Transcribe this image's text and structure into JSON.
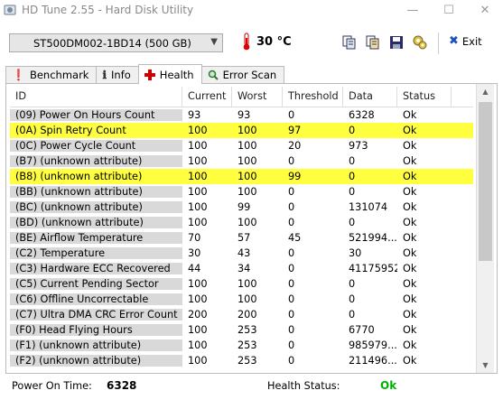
{
  "window": {
    "title": "HD Tune 2.55 - Hard Disk Utility",
    "minimize": "—",
    "maximize": "☐",
    "close": "✕"
  },
  "toolbar": {
    "drive": "ST500DM002-1BD14 (500 GB)",
    "temperature": "30 °C",
    "exit_label": "Exit"
  },
  "tabs": [
    {
      "label": "Benchmark",
      "icon": "benchmark-icon",
      "active": false
    },
    {
      "label": "Info",
      "icon": "info-icon",
      "active": false
    },
    {
      "label": "Health",
      "icon": "health-cross-icon",
      "active": true
    },
    {
      "label": "Error Scan",
      "icon": "magnifier-icon",
      "active": false
    }
  ],
  "table": {
    "columns": [
      "ID",
      "Current",
      "Worst",
      "Threshold",
      "Data",
      "Status"
    ],
    "rows": [
      {
        "id": "(09) Power On Hours Count",
        "current": "93",
        "worst": "93",
        "threshold": "0",
        "data": "6328",
        "status": "Ok",
        "warn": false
      },
      {
        "id": "(0A) Spin Retry Count",
        "current": "100",
        "worst": "100",
        "threshold": "97",
        "data": "0",
        "status": "Ok",
        "warn": true
      },
      {
        "id": "(0C) Power Cycle Count",
        "current": "100",
        "worst": "100",
        "threshold": "20",
        "data": "973",
        "status": "Ok",
        "warn": false
      },
      {
        "id": "(B7) (unknown attribute)",
        "current": "100",
        "worst": "100",
        "threshold": "0",
        "data": "0",
        "status": "Ok",
        "warn": false
      },
      {
        "id": "(B8) (unknown attribute)",
        "current": "100",
        "worst": "100",
        "threshold": "99",
        "data": "0",
        "status": "Ok",
        "warn": true
      },
      {
        "id": "(BB) (unknown attribute)",
        "current": "100",
        "worst": "100",
        "threshold": "0",
        "data": "0",
        "status": "Ok",
        "warn": false
      },
      {
        "id": "(BC) (unknown attribute)",
        "current": "100",
        "worst": "99",
        "threshold": "0",
        "data": "131074",
        "status": "Ok",
        "warn": false
      },
      {
        "id": "(BD) (unknown attribute)",
        "current": "100",
        "worst": "100",
        "threshold": "0",
        "data": "0",
        "status": "Ok",
        "warn": false
      },
      {
        "id": "(BE) Airflow Temperature",
        "current": "70",
        "worst": "57",
        "threshold": "45",
        "data": "521994...",
        "status": "Ok",
        "warn": false
      },
      {
        "id": "(C2) Temperature",
        "current": "30",
        "worst": "43",
        "threshold": "0",
        "data": "30",
        "status": "Ok",
        "warn": false
      },
      {
        "id": "(C3) Hardware ECC Recovered",
        "current": "44",
        "worst": "34",
        "threshold": "0",
        "data": "41175952",
        "status": "Ok",
        "warn": false
      },
      {
        "id": "(C5) Current Pending Sector",
        "current": "100",
        "worst": "100",
        "threshold": "0",
        "data": "0",
        "status": "Ok",
        "warn": false
      },
      {
        "id": "(C6) Offline Uncorrectable",
        "current": "100",
        "worst": "100",
        "threshold": "0",
        "data": "0",
        "status": "Ok",
        "warn": false
      },
      {
        "id": "(C7) Ultra DMA CRC Error Count",
        "current": "200",
        "worst": "200",
        "threshold": "0",
        "data": "0",
        "status": "Ok",
        "warn": false
      },
      {
        "id": "(F0) Head Flying Hours",
        "current": "100",
        "worst": "253",
        "threshold": "0",
        "data": "6770",
        "status": "Ok",
        "warn": false
      },
      {
        "id": "(F1) (unknown attribute)",
        "current": "100",
        "worst": "253",
        "threshold": "0",
        "data": "985979...",
        "status": "Ok",
        "warn": false
      },
      {
        "id": "(F2) (unknown attribute)",
        "current": "100",
        "worst": "253",
        "threshold": "0",
        "data": "211496...",
        "status": "Ok",
        "warn": false
      }
    ]
  },
  "footer": {
    "power_on_label": "Power On Time:",
    "power_on_value": "6328",
    "health_label": "Health Status:",
    "health_value": "Ok"
  },
  "colors": {
    "warn_highlight": "#ffff40",
    "health_ok": "#00b000"
  }
}
